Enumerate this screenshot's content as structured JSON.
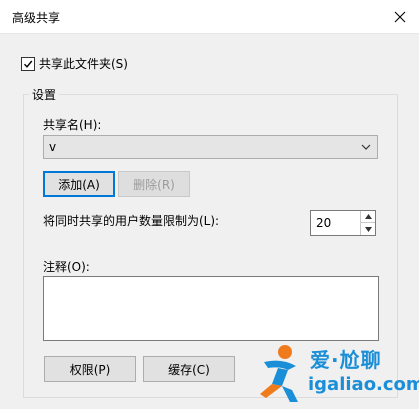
{
  "window": {
    "title": "高级共享",
    "close_icon": "close-icon"
  },
  "share_checkbox": {
    "label": "共享此文件夹(S)",
    "checked": true
  },
  "settings": {
    "group_label": "设置",
    "share_name_label": "共享名(H):",
    "share_name_value": "v",
    "add_button": "添加(A)",
    "remove_button": "删除(R)",
    "limit_label": "将同时共享的用户数量限制为(L):",
    "limit_value": "20",
    "comment_label": "注释(O):",
    "comment_value": ""
  },
  "footer": {
    "permissions_button": "权限(P)",
    "caching_button": "缓存(C)"
  },
  "watermark": {
    "line1": "爱·尬聊",
    "line2": "igaliao.com"
  },
  "colors": {
    "focus_border": "#0078d7",
    "watermark_blue": "#1a8fd8",
    "watermark_orange": "#f07b1d"
  }
}
